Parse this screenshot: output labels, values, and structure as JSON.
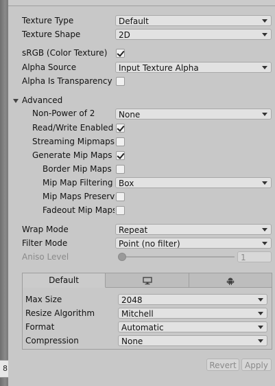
{
  "scene_view": {
    "corner_text": "8"
  },
  "texture": {
    "texture_type": {
      "label": "Texture Type",
      "value": "Default"
    },
    "texture_shape": {
      "label": "Texture Shape",
      "value": "2D"
    },
    "srgb": {
      "label": "sRGB (Color Texture)",
      "checked": true
    },
    "alpha_source": {
      "label": "Alpha Source",
      "value": "Input Texture Alpha"
    },
    "alpha_is_transparency": {
      "label": "Alpha Is Transparency",
      "checked": false
    }
  },
  "advanced": {
    "label": "Advanced",
    "non_power_of_2": {
      "label": "Non-Power of 2",
      "value": "None"
    },
    "read_write": {
      "label": "Read/Write Enabled",
      "checked": true
    },
    "streaming_mipmaps": {
      "label": "Streaming Mipmaps",
      "checked": false
    },
    "generate_mip_maps": {
      "label": "Generate Mip Maps",
      "checked": true
    },
    "border_mip_maps": {
      "label": "Border Mip Maps",
      "checked": false
    },
    "mip_map_filtering": {
      "label": "Mip Map Filtering",
      "value": "Box"
    },
    "mip_maps_preserve": {
      "label": "Mip Maps Preserve",
      "checked": false
    },
    "fadeout_mip_maps": {
      "label": "Fadeout Mip Maps",
      "checked": false
    }
  },
  "wrap_mode": {
    "label": "Wrap Mode",
    "value": "Repeat"
  },
  "filter_mode": {
    "label": "Filter Mode",
    "value": "Point (no filter)"
  },
  "aniso_level": {
    "label": "Aniso Level",
    "value": "1",
    "slider_fraction": 0.0
  },
  "platform": {
    "tabs": [
      {
        "label": "Default",
        "icon": ""
      },
      {
        "label": "",
        "icon": "monitor-icon"
      },
      {
        "label": "",
        "icon": "android-icon"
      }
    ],
    "max_size": {
      "label": "Max Size",
      "value": "2048"
    },
    "resize_algorithm": {
      "label": "Resize Algorithm",
      "value": "Mitchell"
    },
    "format": {
      "label": "Format",
      "value": "Automatic"
    },
    "compression": {
      "label": "Compression",
      "value": "None"
    }
  },
  "buttons": {
    "revert": "Revert",
    "apply": "Apply"
  }
}
